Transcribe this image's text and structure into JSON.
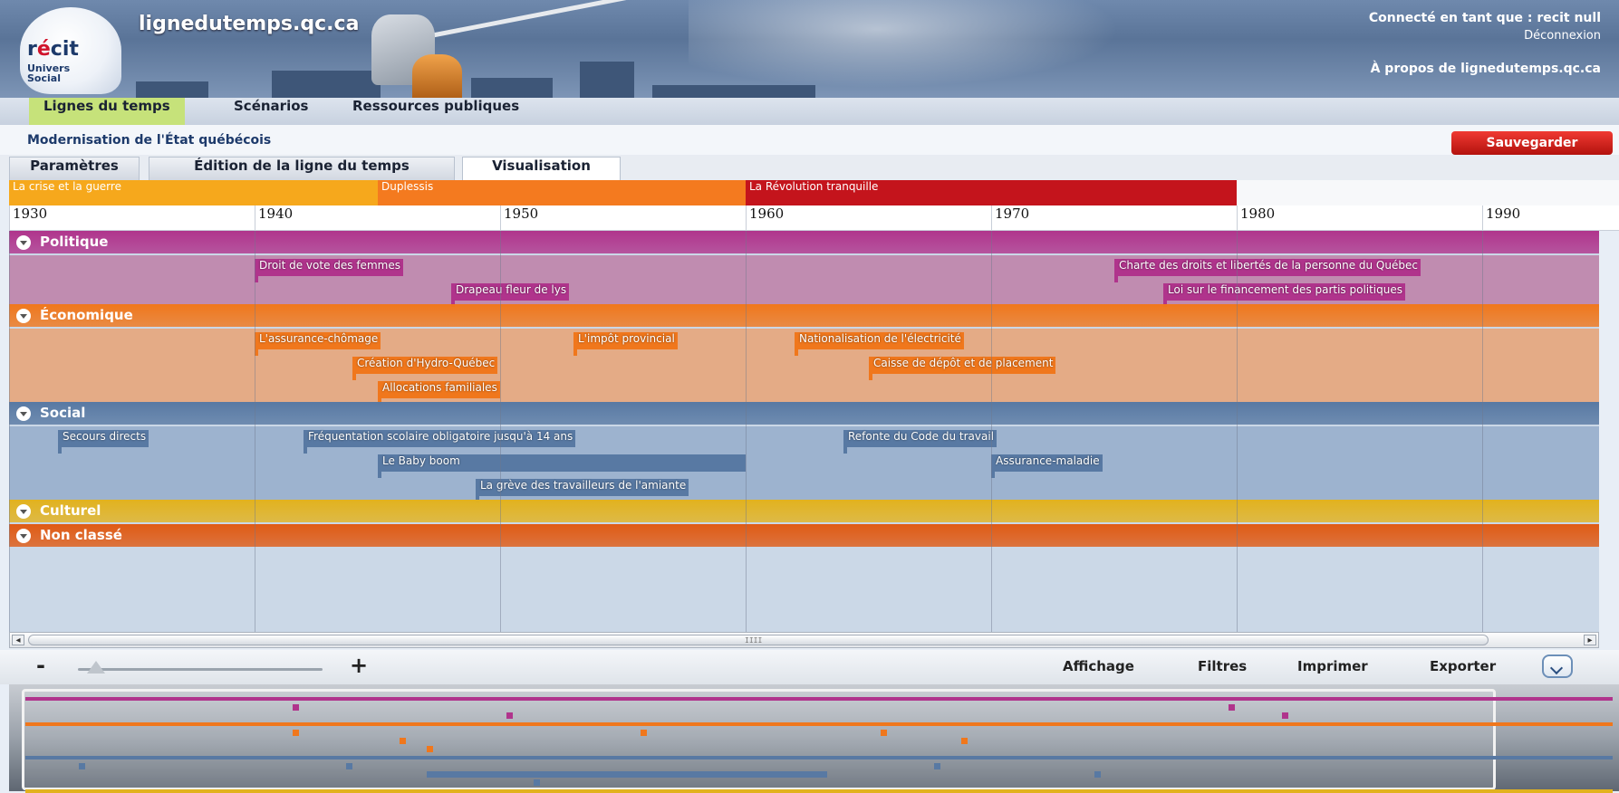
{
  "header": {
    "site_title": "lignedutemps.qc.ca",
    "logo_recit_prefix": "r",
    "logo_recit_highlight": "é",
    "logo_recit_suffix": "cit",
    "logo_univers": "Univers",
    "logo_social": "Social",
    "user_line": "Connecté en tant que : recit null",
    "logout_label": "Déconnexion",
    "about_label": "À propos de lignedutemps.qc.ca"
  },
  "menu": {
    "items": [
      {
        "label": "Lignes du temps",
        "active": true
      },
      {
        "label": "Scénarios",
        "active": false
      },
      {
        "label": "Ressources publiques",
        "active": false
      }
    ]
  },
  "project": {
    "title": "Modernisation de l'État québécois",
    "save_label": "Sauvegarder"
  },
  "tabs": [
    {
      "label": "Paramètres"
    },
    {
      "label": "Édition de la ligne du temps"
    },
    {
      "label": "Visualisation",
      "active": true
    }
  ],
  "timeline": {
    "periods": [
      {
        "label": "La crise et la guerre",
        "start": 1930,
        "end": 1945,
        "color": "#f6a81c"
      },
      {
        "label": "Duplessis",
        "start": 1945,
        "end": 1960,
        "color": "#f47a1f"
      },
      {
        "label": "La Révolution tranquille",
        "start": 1960,
        "end": 1980,
        "color": "#c4141c"
      }
    ],
    "years": [
      "1930",
      "1940",
      "1950",
      "1960",
      "1970",
      "1980",
      "1990"
    ],
    "categories": [
      {
        "name": "Politique",
        "color": "#b0348c",
        "band_color": "#c08cb0",
        "events": [
          {
            "label": "Droit de vote des femmes",
            "year": 1940,
            "row": 0
          },
          {
            "label": "Charte des droits et libertés de la personne du Québec",
            "year": 1975,
            "row": 0
          },
          {
            "label": "Drapeau fleur de lys",
            "year": 1948,
            "row": 1
          },
          {
            "label": "Loi sur le financement des partis politiques",
            "year": 1977,
            "row": 1
          }
        ]
      },
      {
        "name": "Économique",
        "color": "#f0771c",
        "band_color": "#e4ab86",
        "events": [
          {
            "label": "L'assurance-chômage",
            "year": 1940,
            "row": 0
          },
          {
            "label": "L'impôt provincial",
            "year": 1953,
            "row": 0
          },
          {
            "label": "Nationalisation de l'électricité",
            "year": 1962,
            "row": 0
          },
          {
            "label": "Création d'Hydro-Québec",
            "year": 1944,
            "row": 1
          },
          {
            "label": "Caisse de dépôt et de placement",
            "year": 1965,
            "row": 1
          },
          {
            "label": "Allocations familiales",
            "year": 1945,
            "row": 2
          }
        ]
      },
      {
        "name": "Social",
        "color": "#5879a3",
        "band_color": "#9db3cf",
        "events": [
          {
            "label": "Secours directs",
            "year": 1932,
            "row": 0
          },
          {
            "label": "Fréquentation scolaire obligatoire jusqu'à 14 ans",
            "year": 1942,
            "row": 0
          },
          {
            "label": "Refonte du Code du travail",
            "year": 1964,
            "row": 0
          },
          {
            "label": "Le Baby boom",
            "year": 1945,
            "end": 1960,
            "row": 1
          },
          {
            "label": "Assurance-maladie",
            "year": 1970,
            "row": 1
          },
          {
            "label": "La grève des travailleurs de l'amiante",
            "year": 1949,
            "row": 2
          }
        ]
      },
      {
        "name": "Culturel",
        "color": "#e2b21e",
        "band_color": "#cbd8e7",
        "events": []
      },
      {
        "name": "Non classé",
        "color": "#e05a14",
        "band_color": "#cbd8e7",
        "events": []
      }
    ]
  },
  "scrollbar": {
    "left_arrow": "◂",
    "right_arrow": "▸",
    "grip": "IIII"
  },
  "toolbar": {
    "zoom_out": "-",
    "zoom_in": "+",
    "display_label": "Affichage",
    "filters_label": "Filtres",
    "print_label": "Imprimer",
    "export_label": "Exporter"
  }
}
